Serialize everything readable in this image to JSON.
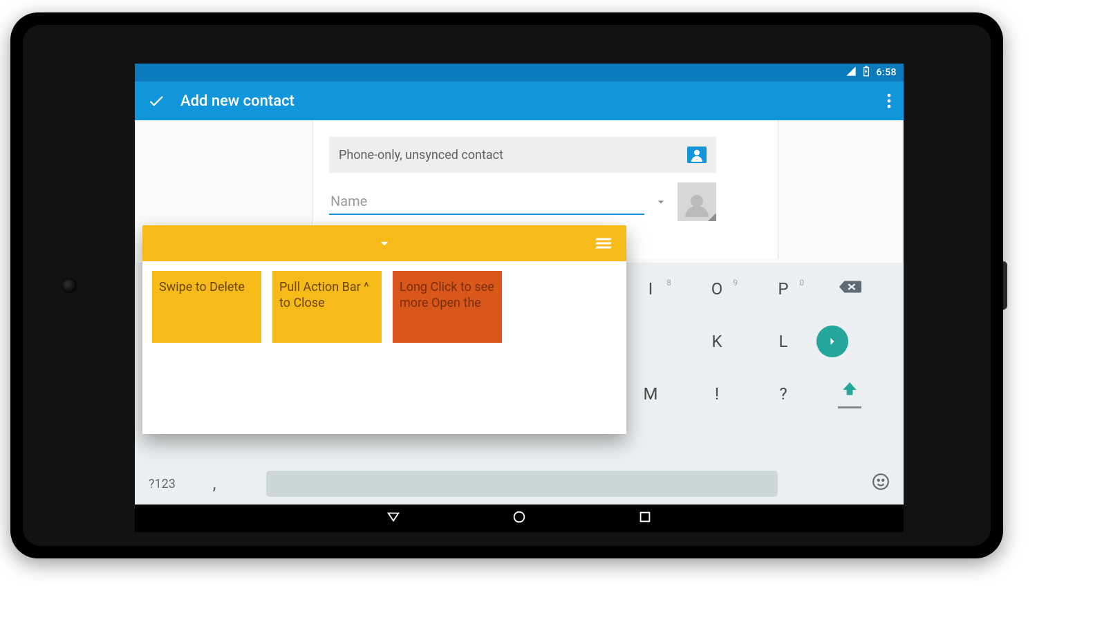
{
  "status": {
    "time": "6:58"
  },
  "appbar": {
    "title": "Add new contact"
  },
  "contact_form": {
    "account_label": "Phone-only, unsynced contact",
    "name_placeholder": "Name",
    "name_value": ""
  },
  "notes_panel": {
    "notes": [
      {
        "text": "Swipe to Delete",
        "color": "yellow"
      },
      {
        "text": "Pull Action Bar ^ to Close",
        "color": "yellow"
      },
      {
        "text": "Long Click to see more Open the",
        "color": "orange"
      }
    ]
  },
  "keyboard": {
    "symbols_label": "?123",
    "comma_label": ",",
    "row1": [
      {
        "char": "I",
        "sup": "8"
      },
      {
        "char": "O",
        "sup": "9"
      },
      {
        "char": "P",
        "sup": "0"
      }
    ],
    "row2": [
      {
        "char": "K"
      },
      {
        "char": "L"
      }
    ],
    "row3": [
      {
        "char": "M"
      },
      {
        "char": "!"
      },
      {
        "char": "?"
      }
    ]
  }
}
